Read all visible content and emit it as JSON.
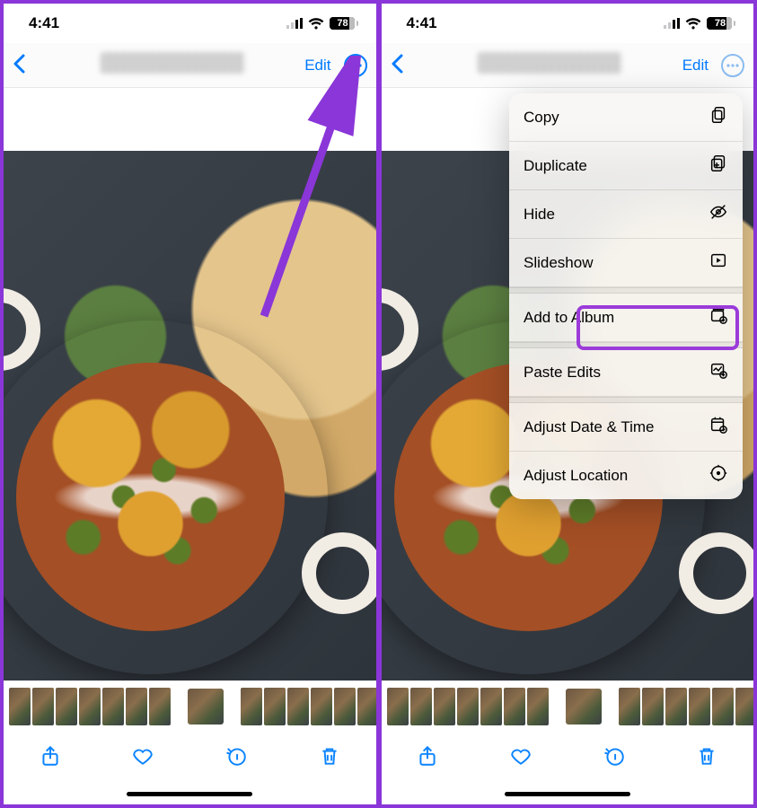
{
  "status": {
    "time": "4:41",
    "battery": "78"
  },
  "nav": {
    "edit": "Edit"
  },
  "menu": {
    "copy": "Copy",
    "duplicate": "Duplicate",
    "hide": "Hide",
    "slideshow": "Slideshow",
    "add_album": "Add to Album",
    "paste_edits": "Paste Edits",
    "adjust_dt": "Adjust Date & Time",
    "adjust_loc": "Adjust Location"
  },
  "accent": "#007aff",
  "highlight": "#9b3bd9"
}
